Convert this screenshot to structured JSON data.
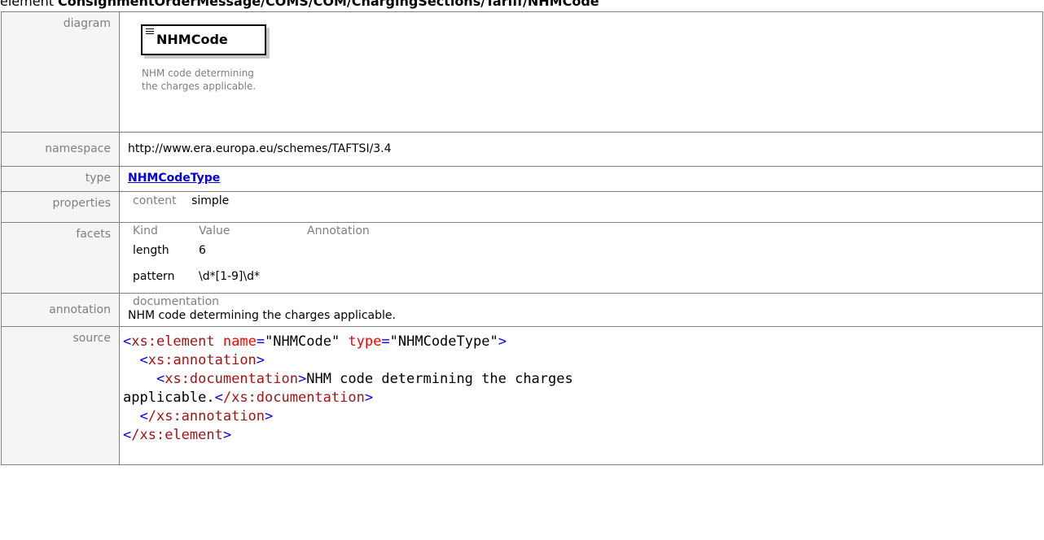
{
  "title": {
    "kind": "element",
    "path": "ConsignmentOrderMessage/COMS/COM/ChargingSections/Tariff/NHMCode"
  },
  "labels": {
    "diagram": "diagram",
    "namespace": "namespace",
    "type": "type",
    "properties": "properties",
    "facets": "facets",
    "annotation": "annotation",
    "source": "source"
  },
  "diagram": {
    "node_name": "NHMCode",
    "node_doc": "NHM code determining the charges applicable."
  },
  "namespace": "http://www.era.europa.eu/schemes/TAFTSI/3.4",
  "type": "NHMCodeType",
  "properties": {
    "key": "content",
    "value": "simple"
  },
  "facets": {
    "headers": [
      "Kind",
      "Value",
      "Annotation"
    ],
    "rows": [
      {
        "kind": "length",
        "value": "6",
        "annotation": ""
      },
      {
        "kind": "pattern",
        "value": "\\d*[1-9]\\d*",
        "annotation": ""
      }
    ]
  },
  "annotation": {
    "key": "documentation",
    "text": "NHM code determining the charges applicable."
  },
  "source": {
    "l1_tag": "xs:element",
    "l1_attr1": "name",
    "l1_val1": "\"NHMCode\"",
    "l1_attr2": "type",
    "l1_val2": "\"NHMCodeType\"",
    "l2_tag": "xs:annotation",
    "l3_tag": "xs:documentation",
    "l3_text": "NHM code determining the charges",
    "l4_text": "applicable.",
    "l4_close": "/xs:documentation",
    "l5_close": "/xs:annotation",
    "l6_close": "/xs:element"
  }
}
